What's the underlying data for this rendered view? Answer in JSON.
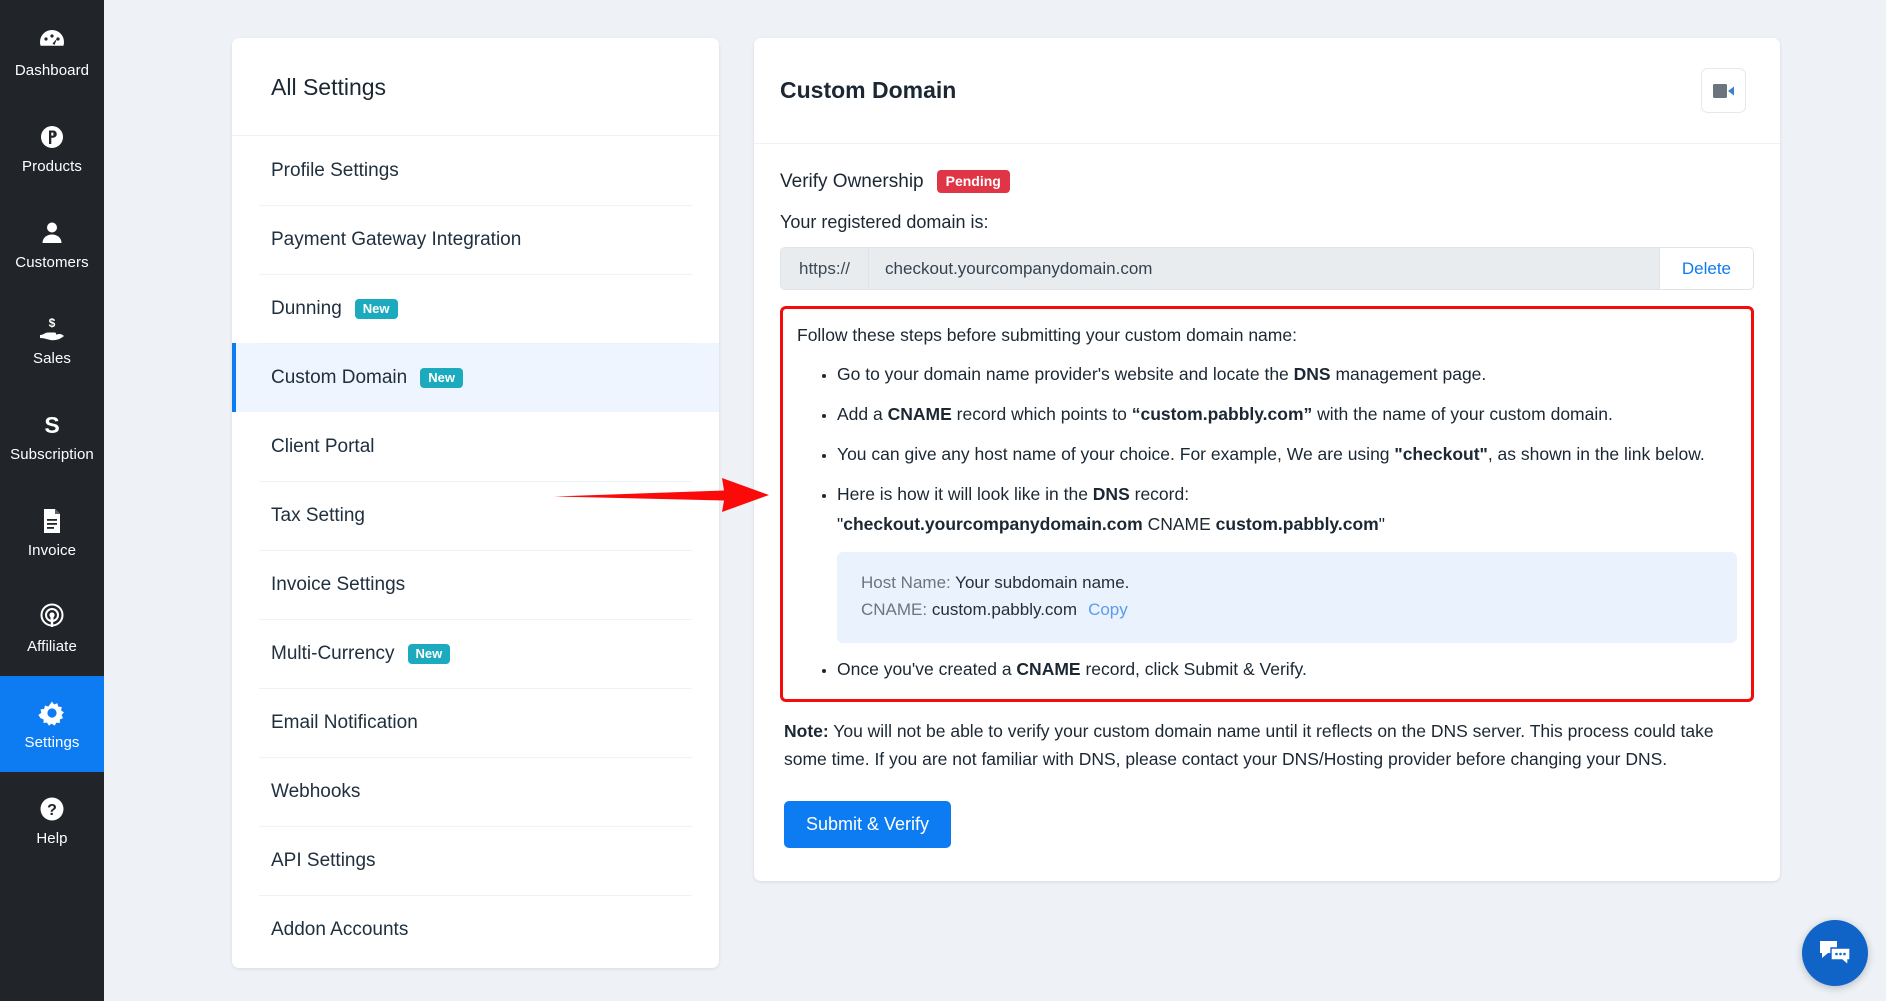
{
  "sidebar": {
    "items": [
      {
        "label": "Dashboard",
        "icon": "dashboard-icon",
        "active": false
      },
      {
        "label": "Products",
        "icon": "products-icon",
        "active": false
      },
      {
        "label": "Customers",
        "icon": "customers-icon",
        "active": false
      },
      {
        "label": "Sales",
        "icon": "sales-icon",
        "active": false
      },
      {
        "label": "Subscription",
        "icon": "subscription-icon",
        "active": false
      },
      {
        "label": "Invoice",
        "icon": "invoice-icon",
        "active": false
      },
      {
        "label": "Affiliate",
        "icon": "affiliate-icon",
        "active": false
      },
      {
        "label": "Settings",
        "icon": "gear-icon",
        "active": true
      },
      {
        "label": "Help",
        "icon": "help-icon",
        "active": false
      }
    ]
  },
  "settings_panel": {
    "title": "All Settings",
    "items": [
      {
        "label": "Profile Settings",
        "badge": "",
        "active": false
      },
      {
        "label": "Payment Gateway Integration",
        "badge": "",
        "active": false
      },
      {
        "label": "Dunning",
        "badge": "New",
        "active": false
      },
      {
        "label": "Custom Domain",
        "badge": "New",
        "active": true
      },
      {
        "label": "Client Portal",
        "badge": "",
        "active": false
      },
      {
        "label": "Tax Setting",
        "badge": "",
        "active": false
      },
      {
        "label": "Invoice Settings",
        "badge": "",
        "active": false
      },
      {
        "label": "Multi-Currency",
        "badge": "New",
        "active": false
      },
      {
        "label": "Email Notification",
        "badge": "",
        "active": false
      },
      {
        "label": "Webhooks",
        "badge": "",
        "active": false
      },
      {
        "label": "API Settings",
        "badge": "",
        "active": false
      },
      {
        "label": "Addon Accounts",
        "badge": "",
        "active": false
      }
    ]
  },
  "main": {
    "title": "Custom Domain",
    "video_icon": "video-camera-icon",
    "verify": {
      "label": "Verify Ownership",
      "status": "Pending"
    },
    "registered_label": "Your registered domain is:",
    "domain_field": {
      "prefix": "https://",
      "value": "checkout.yourcompanydomain.com",
      "placeholder": "checkout.yourcompanydomain.com",
      "delete_label": "Delete"
    },
    "steps": {
      "intro": "Follow these steps before submitting your custom domain name:",
      "items": [
        "Go to your domain name provider's website and locate the DNS management page.",
        "Add a CNAME record which points to “custom.pabbly.com” with the name of your custom domain.",
        "You can give any host name of your choice. For example, We are using \"checkout\", as shown in the link below.",
        "Here is how it will look like in the DNS record:",
        "Once you've created a CNAME record, click Submit & Verify."
      ],
      "dns_example": "\"checkout.yourcompanydomain.com CNAME custom.pabbly.com\"",
      "cname_box": {
        "host_label": "Host Name:",
        "host_value": "Your subdomain name.",
        "cname_label": "CNAME:",
        "cname_value": "custom.pabbly.com",
        "copy_label": "Copy"
      }
    },
    "note": {
      "label": "Note:",
      "text": " You will not be able to verify your custom domain name until it reflects on the DNS server. This process could take some time. If you are not familiar with DNS, please contact your DNS/Hosting provider before changing your DNS."
    },
    "submit_label": "Submit & Verify"
  },
  "chat_widget": {
    "icon": "chat-bubbles-icon"
  },
  "annotation": {
    "arrow": "red-right-arrow"
  },
  "colors": {
    "sidebar_bg": "#212529",
    "accent_blue": "#0d7cf2",
    "badge_new": "#1cabbe",
    "badge_pending": "#e03546",
    "annotation_red": "#f60b0b",
    "page_bg": "#eef2f6",
    "info_box_bg": "#eaf2fd"
  }
}
